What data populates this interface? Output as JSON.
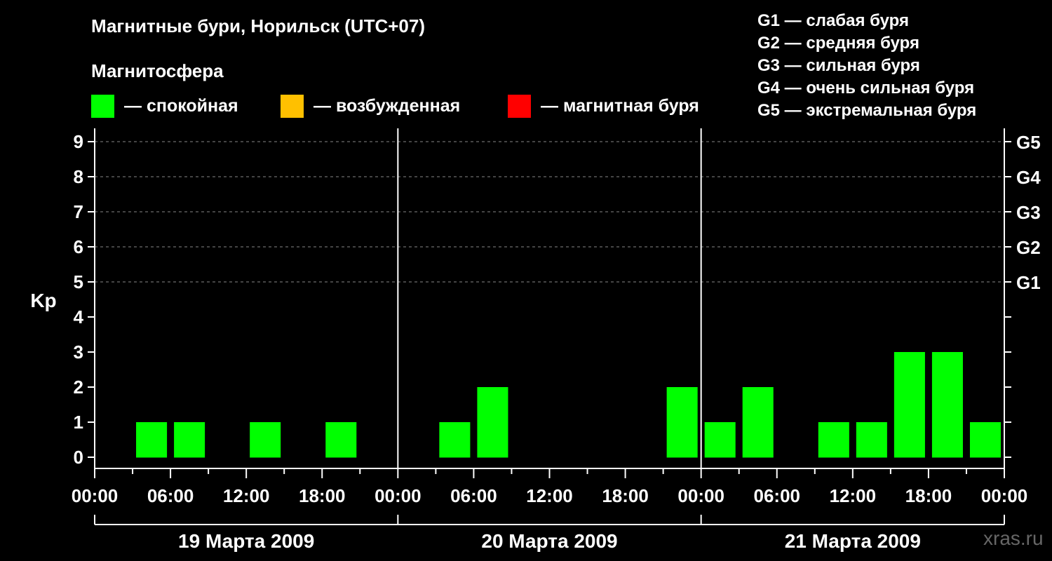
{
  "title": "Магнитные бури, Норильск (UTC+07)",
  "subtitle": "Магнитосфера",
  "legend": [
    {
      "label": "— спокойная",
      "color": "#00ff00"
    },
    {
      "label": "— возбужденная",
      "color": "#ffc000"
    },
    {
      "label": "— магнитная буря",
      "color": "#ff0000"
    }
  ],
  "storm_scale": [
    "G1 — слабая буря",
    "G2 — средняя буря",
    "G3 — сильная буря",
    "G4 — очень сильная буря",
    "G5 — экстремальная буря"
  ],
  "watermark": "xras.ru",
  "chart_data": {
    "type": "bar",
    "ylabel": "Kp",
    "ylim": [
      0,
      9
    ],
    "yticks": [
      "0",
      "1",
      "2",
      "3",
      "4",
      "5",
      "6",
      "7",
      "8",
      "9"
    ],
    "right_ticks": [
      {
        "value": 5,
        "label": "G1"
      },
      {
        "value": 6,
        "label": "G2"
      },
      {
        "value": 7,
        "label": "G3"
      },
      {
        "value": 8,
        "label": "G4"
      },
      {
        "value": 9,
        "label": "G5"
      }
    ],
    "xticks": [
      "00:00",
      "06:00",
      "12:00",
      "18:00",
      "00:00",
      "06:00",
      "12:00",
      "18:00",
      "00:00",
      "06:00",
      "12:00",
      "18:00",
      "00:00"
    ],
    "days": [
      "19 Марта 2009",
      "20 Марта 2009",
      "21 Марта 2009"
    ],
    "bar_color": "#00ff00",
    "grid": "dashed at 5,6,7,8,9",
    "values": [
      [
        0,
        1,
        1,
        0,
        1,
        0,
        1,
        0
      ],
      [
        0,
        1,
        2,
        0,
        0,
        0,
        0,
        2
      ],
      [
        1,
        2,
        0,
        1,
        1,
        3,
        3,
        1
      ]
    ]
  }
}
